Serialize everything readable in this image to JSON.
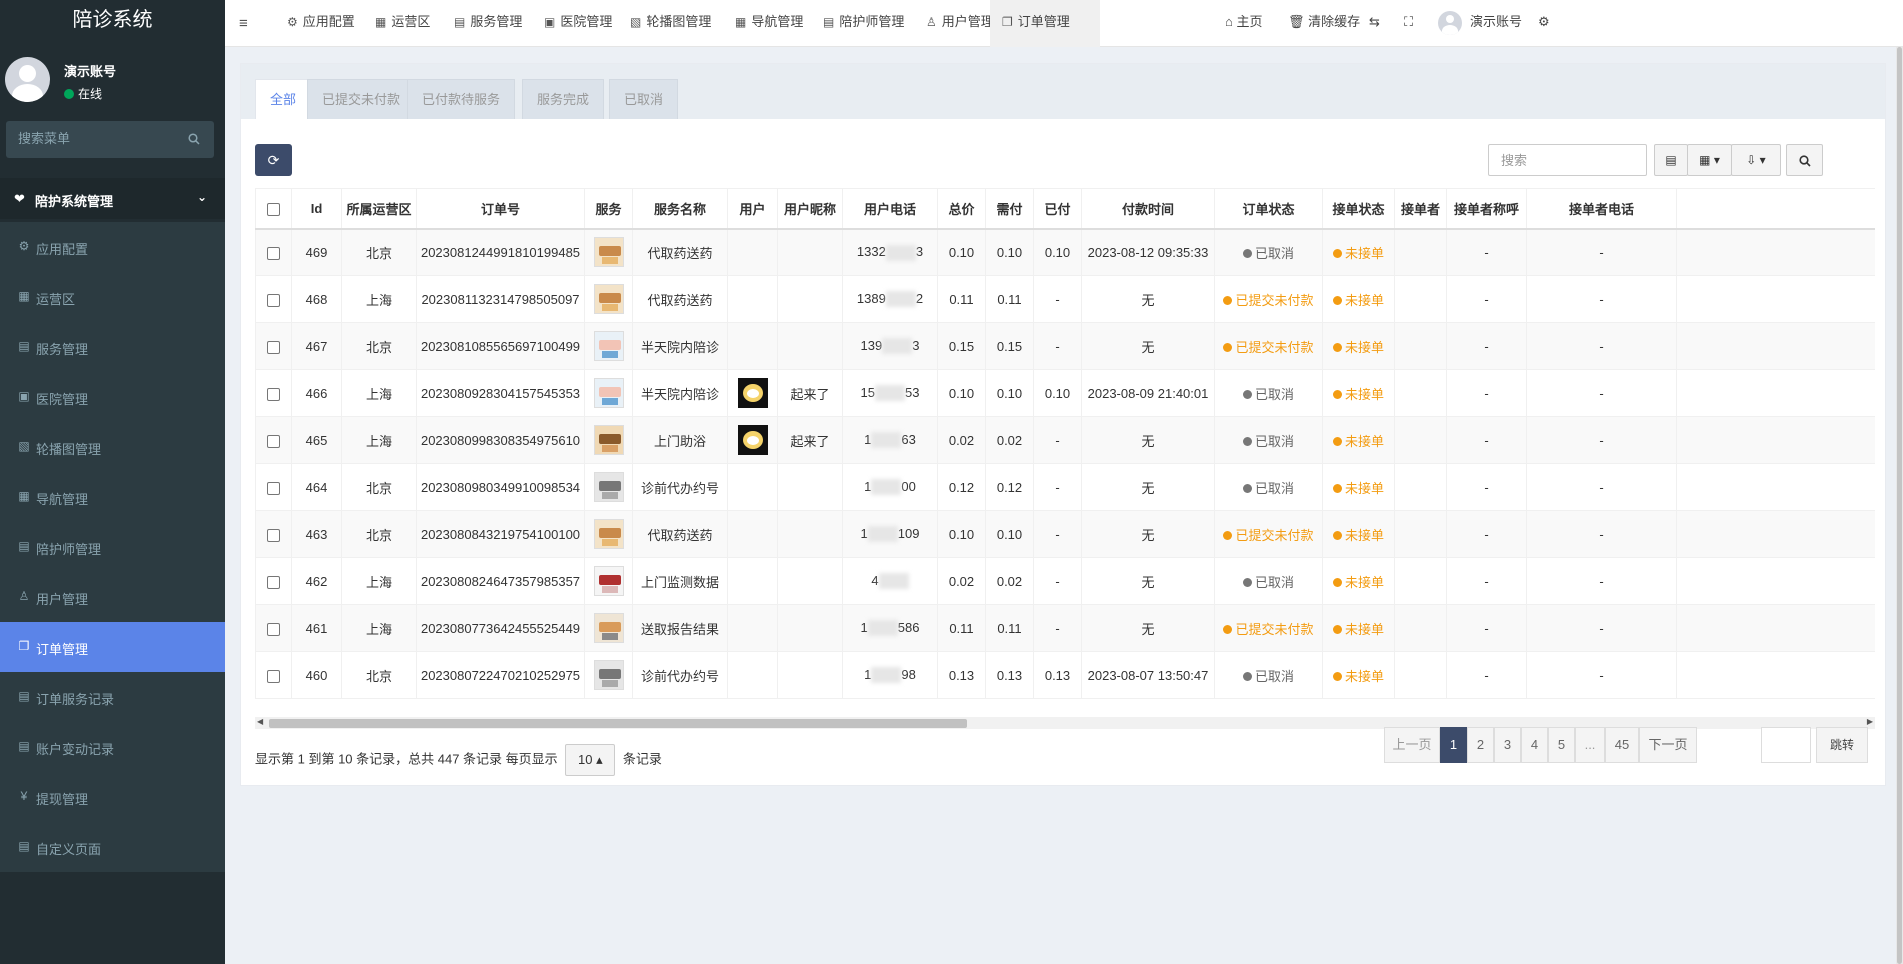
{
  "brand": "陪诊系统",
  "user": {
    "name": "演示账号",
    "status": "在线"
  },
  "sidebar_search": {
    "placeholder": "搜索菜单"
  },
  "menu_header": "陪护系统管理",
  "menu": [
    {
      "label": "应用配置",
      "icon": "gear-icon",
      "glyph": "⚙"
    },
    {
      "label": "运营区",
      "icon": "map-icon",
      "glyph": "▦"
    },
    {
      "label": "服务管理",
      "icon": "list-icon",
      "glyph": "▤"
    },
    {
      "label": "医院管理",
      "icon": "hospital-icon",
      "glyph": "▣"
    },
    {
      "label": "轮播图管理",
      "icon": "image-icon",
      "glyph": "▧"
    },
    {
      "label": "导航管理",
      "icon": "grid-icon",
      "glyph": "▦"
    },
    {
      "label": "陪护师管理",
      "icon": "id-card-icon",
      "glyph": "▤"
    },
    {
      "label": "用户管理",
      "icon": "user-icon",
      "glyph": "♙"
    },
    {
      "label": "订单管理",
      "icon": "copy-icon",
      "glyph": "❐",
      "active": true
    },
    {
      "label": "订单服务记录",
      "icon": "file-icon",
      "glyph": "▤"
    },
    {
      "label": "账户变动记录",
      "icon": "file-icon",
      "glyph": "▤"
    },
    {
      "label": "提现管理",
      "icon": "yen-icon",
      "glyph": "¥"
    },
    {
      "label": "自定义页面",
      "icon": "file-icon",
      "glyph": "▤"
    }
  ],
  "topnav": [
    {
      "label": "应用配置",
      "icon": "gear-icon",
      "glyph": "⚙"
    },
    {
      "label": "运营区",
      "icon": "map-icon",
      "glyph": "▦"
    },
    {
      "label": "服务管理",
      "icon": "list-icon",
      "glyph": "▤"
    },
    {
      "label": "医院管理",
      "icon": "hospital-icon",
      "glyph": "▣"
    },
    {
      "label": "轮播图管理",
      "icon": "image-icon",
      "glyph": "▧"
    },
    {
      "label": "导航管理",
      "icon": "grid-icon",
      "glyph": "▦"
    },
    {
      "label": "陪护师管理",
      "icon": "id-card-icon",
      "glyph": "▤"
    },
    {
      "label": "用户管理",
      "icon": "user-icon",
      "glyph": "♙"
    },
    {
      "label": "订单管理",
      "icon": "copy-icon",
      "glyph": "❐",
      "active": true
    }
  ],
  "topright": {
    "home": "主页",
    "clear_cache": "清除缓存",
    "account": "演示账号"
  },
  "tabs": [
    "全部",
    "已提交未付款",
    "已付款待服务",
    "服务完成",
    "已取消"
  ],
  "search": {
    "placeholder": "搜索"
  },
  "columns": [
    "Id",
    "所属运营区",
    "订单号",
    "服务",
    "服务名称",
    "用户",
    "用户昵称",
    "用户电话",
    "总价",
    "需付",
    "已付",
    "付款时间",
    "订单状态",
    "接单状态",
    "接单者",
    "接单者称呼",
    "接单者电话"
  ],
  "rows": [
    {
      "id": "469",
      "region": "北京",
      "order_no": "2023081244991810199485",
      "service_name": "代取药送药",
      "user": false,
      "nickname": "",
      "phone_a": "1332",
      "phone_b": "3",
      "total": "0.10",
      "due": "0.10",
      "paid": "0.10",
      "pay_time": "2023-08-12 09:35:33",
      "status": "已取消",
      "status_type": "cancel",
      "accept": "未接单",
      "taker": "",
      "taker_name": "-",
      "taker_phone": "-",
      "img": "pharmacy"
    },
    {
      "id": "468",
      "region": "上海",
      "order_no": "2023081132314798505097",
      "service_name": "代取药送药",
      "user": false,
      "nickname": "",
      "phone_a": "1389",
      "phone_b": "2",
      "total": "0.11",
      "due": "0.11",
      "paid": "-",
      "pay_time": "无",
      "status": "已提交未付款",
      "status_type": "unpaid",
      "accept": "未接单",
      "taker": "",
      "taker_name": "-",
      "taker_phone": "-",
      "img": "pharmacy"
    },
    {
      "id": "467",
      "region": "北京",
      "order_no": "2023081085565697100499",
      "service_name": "半天院内陪诊",
      "user": false,
      "nickname": "",
      "phone_a": "139",
      "phone_b": "3",
      "total": "0.15",
      "due": "0.15",
      "paid": "-",
      "pay_time": "无",
      "status": "已提交未付款",
      "status_type": "unpaid",
      "accept": "未接单",
      "taker": "",
      "taker_name": "-",
      "taker_phone": "-",
      "img": "nurse"
    },
    {
      "id": "466",
      "region": "上海",
      "order_no": "2023080928304157545353",
      "service_name": "半天院内陪诊",
      "user": true,
      "nickname": "起来了",
      "phone_a": "15",
      "phone_b": "53",
      "total": "0.10",
      "due": "0.10",
      "paid": "0.10",
      "pay_time": "2023-08-09 21:40:01",
      "status": "已取消",
      "status_type": "cancel",
      "accept": "未接单",
      "taker": "",
      "taker_name": "-",
      "taker_phone": "-",
      "img": "nurse"
    },
    {
      "id": "465",
      "region": "上海",
      "order_no": "2023080998308354975610",
      "service_name": "上门助浴",
      "user": true,
      "nickname": "起来了",
      "phone_a": "1",
      "phone_b": "63",
      "total": "0.02",
      "due": "0.02",
      "paid": "-",
      "pay_time": "无",
      "status": "已取消",
      "status_type": "cancel",
      "accept": "未接单",
      "taker": "",
      "taker_name": "-",
      "taker_phone": "-",
      "img": "bath"
    },
    {
      "id": "464",
      "region": "北京",
      "order_no": "2023080980349910098534",
      "service_name": "诊前代办约号",
      "user": false,
      "nickname": "",
      "phone_a": "1",
      "phone_b": "00",
      "total": "0.12",
      "due": "0.12",
      "paid": "-",
      "pay_time": "无",
      "status": "已取消",
      "status_type": "cancel",
      "accept": "未接单",
      "taker": "",
      "taker_name": "-",
      "taker_phone": "-",
      "img": "queue"
    },
    {
      "id": "463",
      "region": "北京",
      "order_no": "2023080843219754100100",
      "service_name": "代取药送药",
      "user": false,
      "nickname": "",
      "phone_a": "1",
      "phone_b": "109",
      "total": "0.10",
      "due": "0.10",
      "paid": "-",
      "pay_time": "无",
      "status": "已提交未付款",
      "status_type": "unpaid",
      "accept": "未接单",
      "taker": "",
      "taker_name": "-",
      "taker_phone": "-",
      "img": "pharmacy"
    },
    {
      "id": "462",
      "region": "上海",
      "order_no": "2023080824647357985357",
      "service_name": "上门监测数据",
      "user": false,
      "nickname": "",
      "phone_a": "4",
      "phone_b": "",
      "total": "0.02",
      "due": "0.02",
      "paid": "-",
      "pay_time": "无",
      "status": "已取消",
      "status_type": "cancel",
      "accept": "未接单",
      "taker": "",
      "taker_name": "-",
      "taker_phone": "-",
      "img": "monitor"
    },
    {
      "id": "461",
      "region": "上海",
      "order_no": "2023080773642455525449",
      "service_name": "送取报告结果",
      "user": false,
      "nickname": "",
      "phone_a": "1",
      "phone_b": "586",
      "total": "0.11",
      "due": "0.11",
      "paid": "-",
      "pay_time": "无",
      "status": "已提交未付款",
      "status_type": "unpaid",
      "accept": "未接单",
      "taker": "",
      "taker_name": "-",
      "taker_phone": "-",
      "img": "report"
    },
    {
      "id": "460",
      "region": "北京",
      "order_no": "2023080722470210252975",
      "service_name": "诊前代办约号",
      "user": false,
      "nickname": "",
      "phone_a": "1",
      "phone_b": "98",
      "total": "0.13",
      "due": "0.13",
      "paid": "0.13",
      "pay_time": "2023-08-07 13:50:47",
      "status": "已取消",
      "status_type": "cancel",
      "accept": "未接单",
      "taker": "",
      "taker_name": "-",
      "taker_phone": "-",
      "img": "queue"
    }
  ],
  "pagination": {
    "info_pre": "显示第 1 到第 10 条记录，总共 447 条记录 每页显示",
    "page_size": "10",
    "info_post": "条记录",
    "prev": "上一页",
    "pages": [
      "1",
      "2",
      "3",
      "4",
      "5",
      "...",
      "45"
    ],
    "next": "下一页",
    "jump": "跳转"
  },
  "colors": {
    "accent": "#5b84e8",
    "sidebar": "#222d32",
    "dark_btn": "#3c4b6a",
    "warn": "#f39c12"
  }
}
